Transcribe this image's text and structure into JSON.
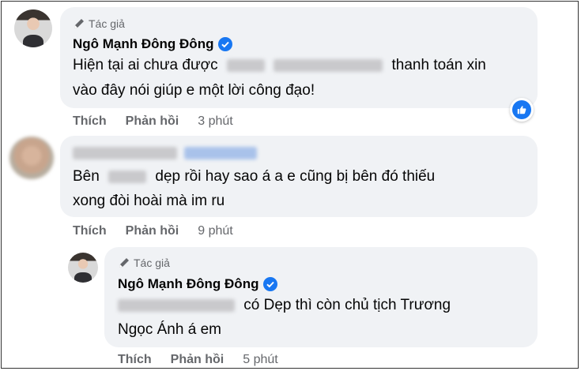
{
  "author_tag": "Tác giả",
  "colors": {
    "accent": "#1877f2",
    "bubble": "#f0f2f5",
    "meta": "#65676b"
  },
  "comments": [
    {
      "name": "Ngô Mạnh Đông Đông",
      "line1_prefix": "Hiện tại ai chưa được",
      "line1_suffix": "thanh toán xin",
      "line2": "vào đây nói giúp e một lời công đạo!",
      "like": "Thích",
      "reply": "Phản hồi",
      "time": "3 phút",
      "reaction_icon": "like-thumb-icon"
    },
    {
      "line1_prefix": "Bên",
      "line1_suffix": "dẹp rồi hay sao á a e cũng bị bên đó thiếu",
      "line2": "xong đòi hoài mà im ru",
      "like": "Thích",
      "reply": "Phản hồi",
      "time": "9 phút"
    },
    {
      "name": "Ngô Mạnh Đông Đông",
      "line1_suffix": "có Dẹp thì còn chủ tịch Trương",
      "line2": "Ngọc Ánh á em",
      "like": "Thích",
      "reply": "Phản hồi",
      "time": "5 phút"
    }
  ]
}
